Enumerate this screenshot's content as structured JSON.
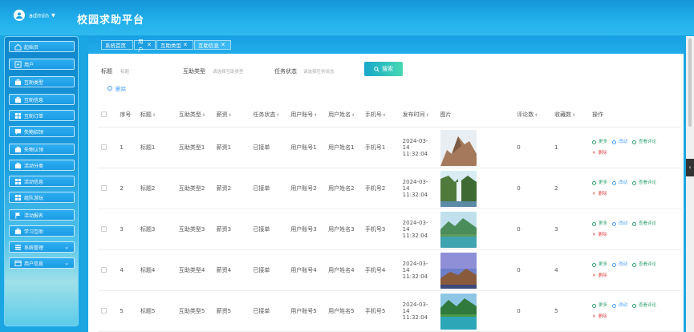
{
  "header": {
    "user": "admin",
    "app_title": "校园求助平台"
  },
  "sidebar": {
    "items": [
      {
        "label": "起始页",
        "icon": "home-icon"
      },
      {
        "label": "用户",
        "icon": "user-icon"
      },
      {
        "label": "互助类型",
        "icon": "briefcase-icon"
      },
      {
        "label": "互助信息",
        "icon": "briefcase-icon"
      },
      {
        "label": "互助订单",
        "icon": "grid-icon"
      },
      {
        "label": "失物招领",
        "icon": "chat-icon"
      },
      {
        "label": "失物认领",
        "icon": "briefcase-icon"
      },
      {
        "label": "活动分类",
        "icon": "briefcase-icon"
      },
      {
        "label": "活动信息",
        "icon": "grid-icon"
      },
      {
        "label": "组队游玩",
        "icon": "grid-icon"
      },
      {
        "label": "活动报名",
        "icon": "flag-icon"
      },
      {
        "label": "学习互助",
        "icon": "briefcase-icon"
      },
      {
        "label": "系统管理",
        "icon": "list-icon",
        "chevron": "⌄"
      },
      {
        "label": "用户信息",
        "icon": "window-icon",
        "chevron": "⌄"
      }
    ]
  },
  "tabs": [
    {
      "label": "系统首页",
      "closable": false
    },
    {
      "label": "用户",
      "closable": true
    },
    {
      "label": "互助类型",
      "closable": true
    },
    {
      "label": "互助信息",
      "closable": true
    }
  ],
  "tab_close_glyph": "✕",
  "search": {
    "title_label": "标题",
    "title_placeholder": "标题",
    "type_label": "互助类型",
    "type_placeholder": "请选择互助类型",
    "status_label": "任务状态",
    "status_placeholder": "请选择任务状态",
    "button": "搜索"
  },
  "delete_label": "删除",
  "table": {
    "headers": [
      "序号",
      "标题",
      "互助类型",
      "薪资",
      "任务状态",
      "用户账号",
      "用户姓名",
      "手机号",
      "发布时间",
      "图片",
      "评论数",
      "收藏数",
      "操作"
    ],
    "sortable": [
      false,
      true,
      true,
      true,
      true,
      true,
      true,
      true,
      true,
      false,
      true,
      true,
      false
    ],
    "sort_glyph": "⬍",
    "rows": [
      {
        "no": "1",
        "title": "标题1",
        "type": "互助类型1",
        "salary": "薪资1",
        "status": "已接单",
        "account": "用户账号1",
        "name": "用户姓名1",
        "phone": "手机号1",
        "time": "2024-03-14 11:32:04",
        "comments": "0",
        "favorites": "1",
        "image": "mountain-cliff"
      },
      {
        "no": "2",
        "title": "标题2",
        "type": "互助类型2",
        "salary": "薪资2",
        "status": "已接单",
        "account": "用户账号2",
        "name": "用户姓名2",
        "phone": "手机号2",
        "time": "2024-03-14 11:32:04",
        "comments": "0",
        "favorites": "2",
        "image": "waterfall"
      },
      {
        "no": "3",
        "title": "标题3",
        "type": "互助类型3",
        "salary": "薪资3",
        "status": "已接单",
        "account": "用户账号3",
        "name": "用户姓名3",
        "phone": "手机号3",
        "time": "2024-03-14 11:32:04",
        "comments": "0",
        "favorites": "3",
        "image": "green-valley"
      },
      {
        "no": "4",
        "title": "标题4",
        "type": "互助类型4",
        "salary": "薪资4",
        "status": "已接单",
        "account": "用户账号4",
        "name": "用户姓名4",
        "phone": "手机号4",
        "time": "2024-03-14 11:32:04",
        "comments": "0",
        "favorites": "4",
        "image": "purple-sky"
      },
      {
        "no": "5",
        "title": "标题5",
        "type": "互助类型5",
        "salary": "薪资5",
        "status": "已接单",
        "account": "用户账号5",
        "name": "用户姓名5",
        "phone": "手机号5",
        "time": "2024-03-14 11:32:04",
        "comments": "0",
        "favorites": "5",
        "image": "lake-trees"
      }
    ],
    "actions": {
      "more": "更多",
      "edit": "改动",
      "view": "查看评论",
      "delete": "删除"
    }
  },
  "colors": {
    "primary": "#1aa6e3",
    "link": "#409eff",
    "success": "#2e9f6f",
    "danger": "#e54c4c"
  }
}
